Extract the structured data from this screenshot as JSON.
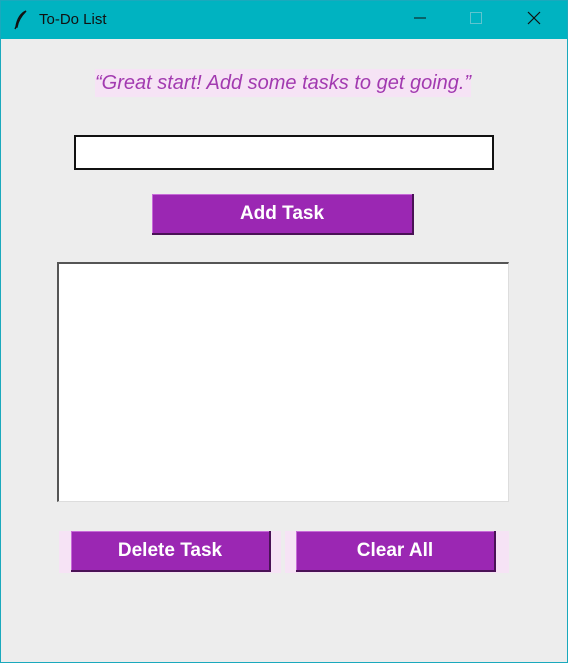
{
  "window": {
    "title": "To-Do List",
    "icon": "feather-icon",
    "controls": [
      "minimize-icon",
      "maximize-icon",
      "close-icon"
    ],
    "titlebar_color": "#00b3c1"
  },
  "quote": {
    "text": "“Great start! Add some tasks to get going.”",
    "color": "#a23ab0",
    "background": "#f6e3f5"
  },
  "task_input": {
    "value": "",
    "placeholder": ""
  },
  "buttons": {
    "add_label": "Add Task",
    "delete_label": "Delete Task",
    "clear_label": "Clear All",
    "color": "#9b27b3"
  },
  "task_list": {
    "items": []
  }
}
